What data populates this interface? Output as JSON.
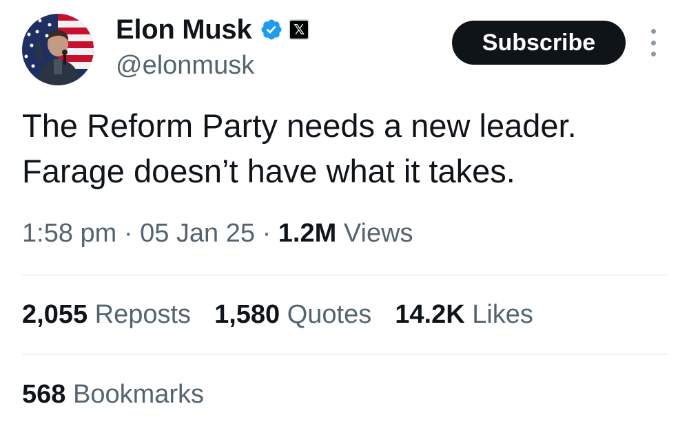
{
  "author": {
    "display_name": "Elon Musk",
    "handle": "@elonmusk",
    "verified_icon": "verified-badge-icon",
    "affiliate_icon": "x-logo-icon",
    "affiliate_glyph": "𝕏",
    "avatar_icon": "profile-photo"
  },
  "subscribe_label": "Subscribe",
  "more_icon": "more-vertical-icon",
  "tweet": {
    "lines": [
      "The Reform Party needs a new leader.",
      "Farage doesn’t have what it takes."
    ]
  },
  "meta": {
    "time": "1:58 pm",
    "separator": "·",
    "date": "05 Jan 25",
    "views_count": "1.2M",
    "views_label": "Views"
  },
  "stats": [
    {
      "count": "2,055",
      "label": "Reposts"
    },
    {
      "count": "1,580",
      "label": "Quotes"
    },
    {
      "count": "14.2K",
      "label": "Likes"
    }
  ],
  "bookmarks": {
    "count": "568",
    "label": "Bookmarks"
  },
  "colors": {
    "text_primary": "#0f1419",
    "text_secondary": "#536471",
    "verified_blue": "#1d9bf0",
    "button_bg": "#0f1419",
    "divider": "#dadfe3"
  }
}
